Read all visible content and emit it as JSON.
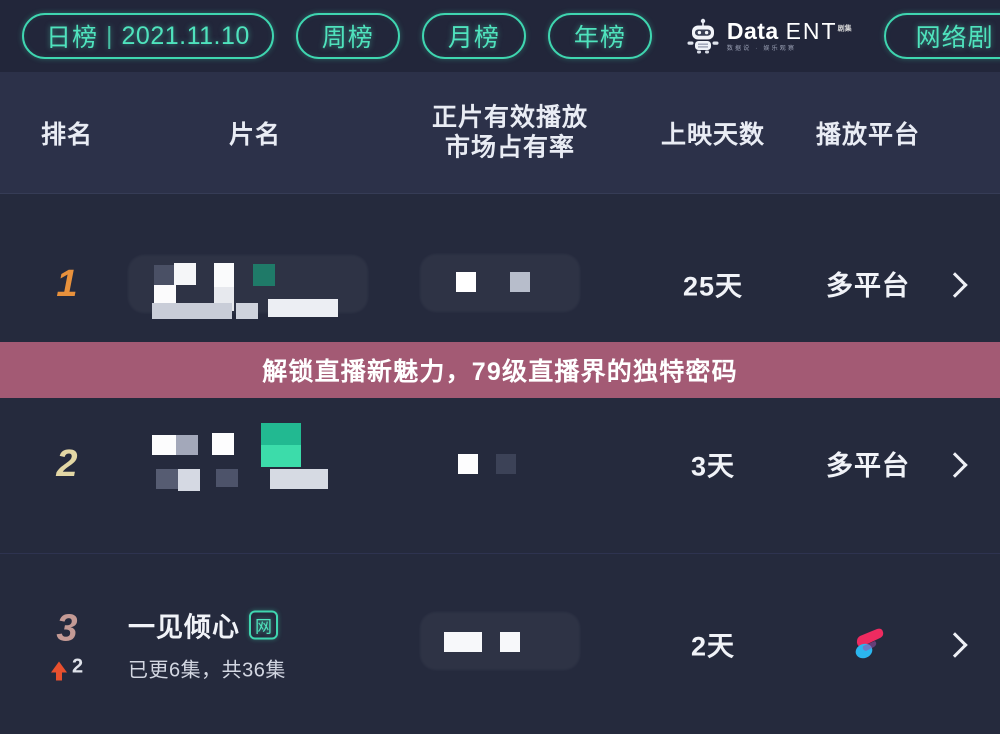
{
  "header": {
    "tabs": [
      {
        "label_zh": "日榜",
        "date": "2021.11.10",
        "name": "daily"
      },
      {
        "label_zh": "周榜",
        "name": "weekly"
      },
      {
        "label_zh": "月榜",
        "name": "monthly"
      },
      {
        "label_zh": "年榜",
        "name": "yearly"
      }
    ],
    "brand": {
      "main": "Data",
      "ent": "ENT",
      "sup": "剧集",
      "sub": "数据说 · 娱乐观察",
      "icon": "robot-icon"
    },
    "category_filter": {
      "label": "网络剧",
      "icon": "chevron-down-icon"
    },
    "accent_color": "#4fe3bd"
  },
  "table": {
    "columns": [
      {
        "key": "rank",
        "label": "排名"
      },
      {
        "key": "title",
        "label": "片名"
      },
      {
        "key": "share",
        "label_line1": "正片有效播放",
        "label_line2": "市场占有率"
      },
      {
        "key": "days",
        "label": "上映天数"
      },
      {
        "key": "platform",
        "label": "播放平台"
      }
    ],
    "rows": [
      {
        "rank": "1",
        "rank_color": "#e8913c",
        "title": "",
        "title_censored": true,
        "subtitle": "",
        "badge": "",
        "share": "",
        "share_censored": true,
        "days": "25天",
        "platform": "多平台",
        "platform_icon": "",
        "delta": "",
        "delta_direction": ""
      },
      {
        "rank": "2",
        "rank_color": "#e3d7a5",
        "title": "",
        "title_censored": true,
        "subtitle": "",
        "badge": "",
        "share": "",
        "share_censored": true,
        "days": "3天",
        "platform": "多平台",
        "platform_icon": "",
        "delta": "",
        "delta_direction": ""
      },
      {
        "rank": "3",
        "rank_color": "#c49a95",
        "title": "一见倾心",
        "title_censored": false,
        "subtitle": "已更6集，共36集",
        "badge": "网",
        "share": "",
        "share_censored": true,
        "days": "2天",
        "platform": "",
        "platform_icon": "mango-tv-logo",
        "delta": "2",
        "delta_direction": "up"
      }
    ],
    "row_chevron_icon": "chevron-right-icon"
  },
  "overlay_banner": {
    "text": "解锁直播新魅力，79级直播界的独特密码",
    "background_color": "#a35a74"
  }
}
